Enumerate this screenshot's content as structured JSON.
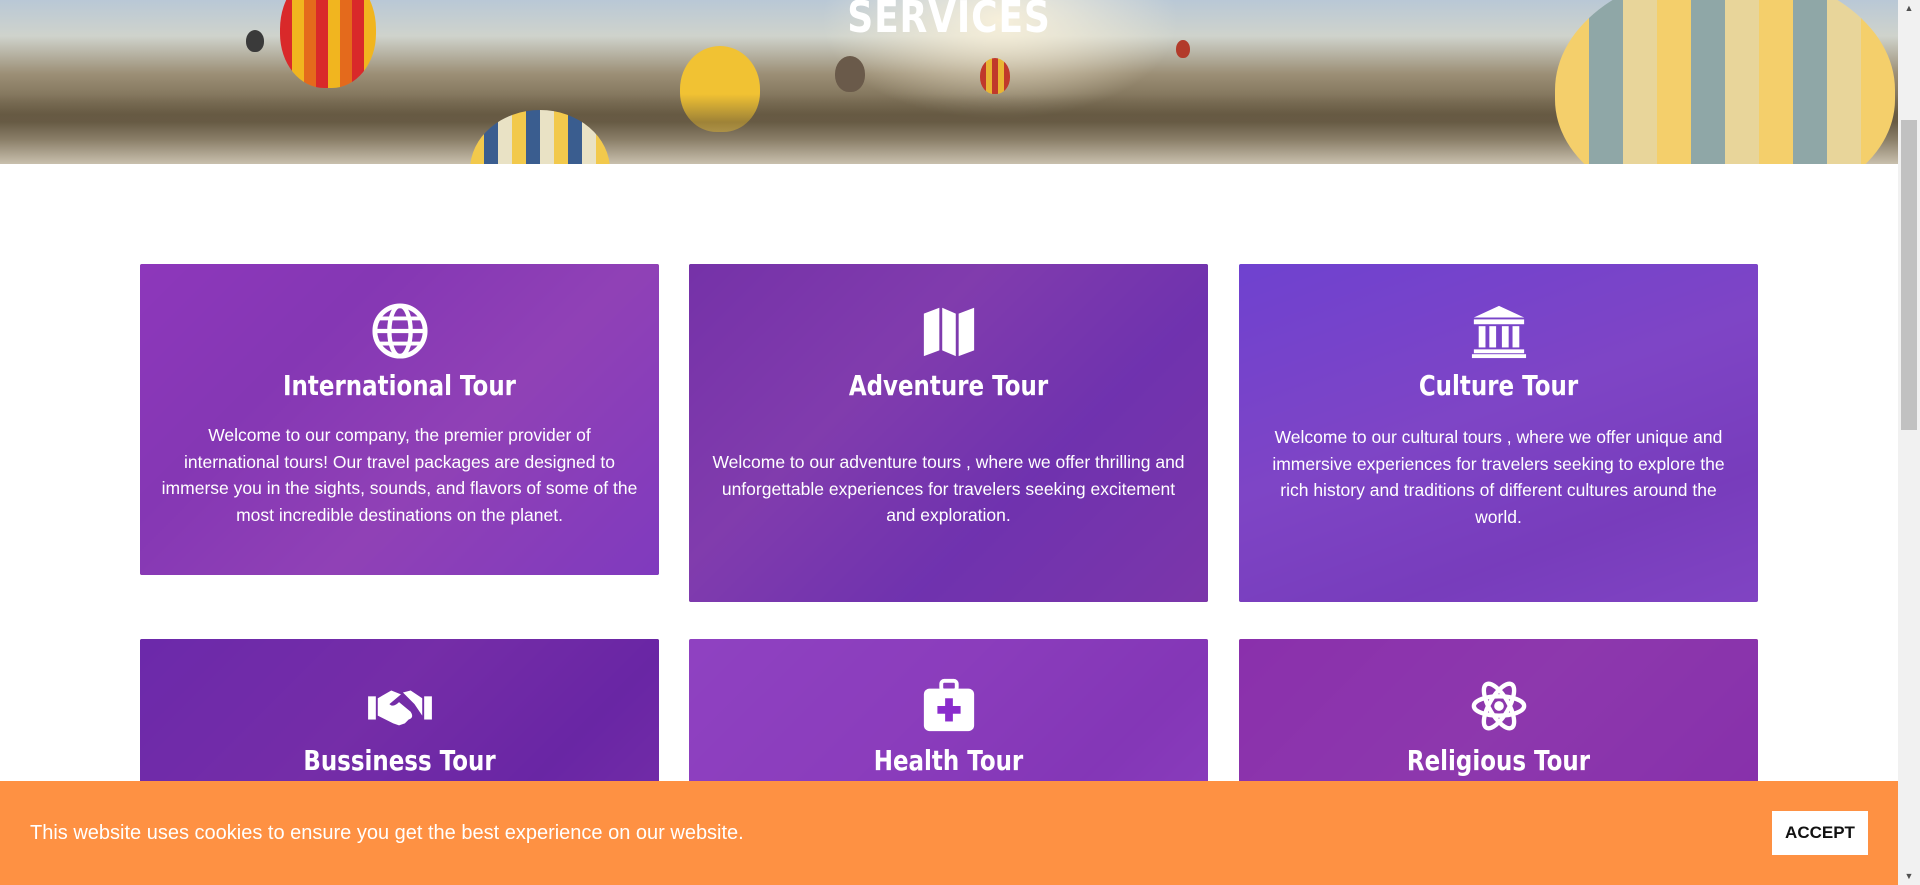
{
  "hero": {
    "title": "SERVICES"
  },
  "services": [
    {
      "title": "International Tour",
      "icon": "globe-icon",
      "description": "Welcome to our company, the premier provider of international tours! Our travel packages are designed to immerse you in the sights, sounds, and flavors of some of the most incredible destinations on the planet."
    },
    {
      "title": "Adventure Tour",
      "icon": "map-icon",
      "description": "Welcome to our adventure tours , where we offer thrilling and unforgettable experiences for travelers seeking excitement and exploration."
    },
    {
      "title": "Culture Tour",
      "icon": "landmark-icon",
      "description": "Welcome to our cultural tours , where we offer unique and immersive experiences for travelers seeking to explore the rich history and traditions of different cultures around the world."
    },
    {
      "title": "Bussiness Tour",
      "icon": "handshake-icon",
      "description": ""
    },
    {
      "title": "Health Tour",
      "icon": "medkit-icon",
      "description": ""
    },
    {
      "title": "Religious Tour",
      "icon": "atom-icon",
      "description": ""
    }
  ],
  "cookie": {
    "message": "This website uses cookies to ensure you get the best experience on our website.",
    "accept_label": "ACCEPT"
  },
  "colors": {
    "card_overlay": "#8a2ccc",
    "cookie_bar": "#fe9143",
    "scrollbar_thumb": "#c1c1c1"
  }
}
